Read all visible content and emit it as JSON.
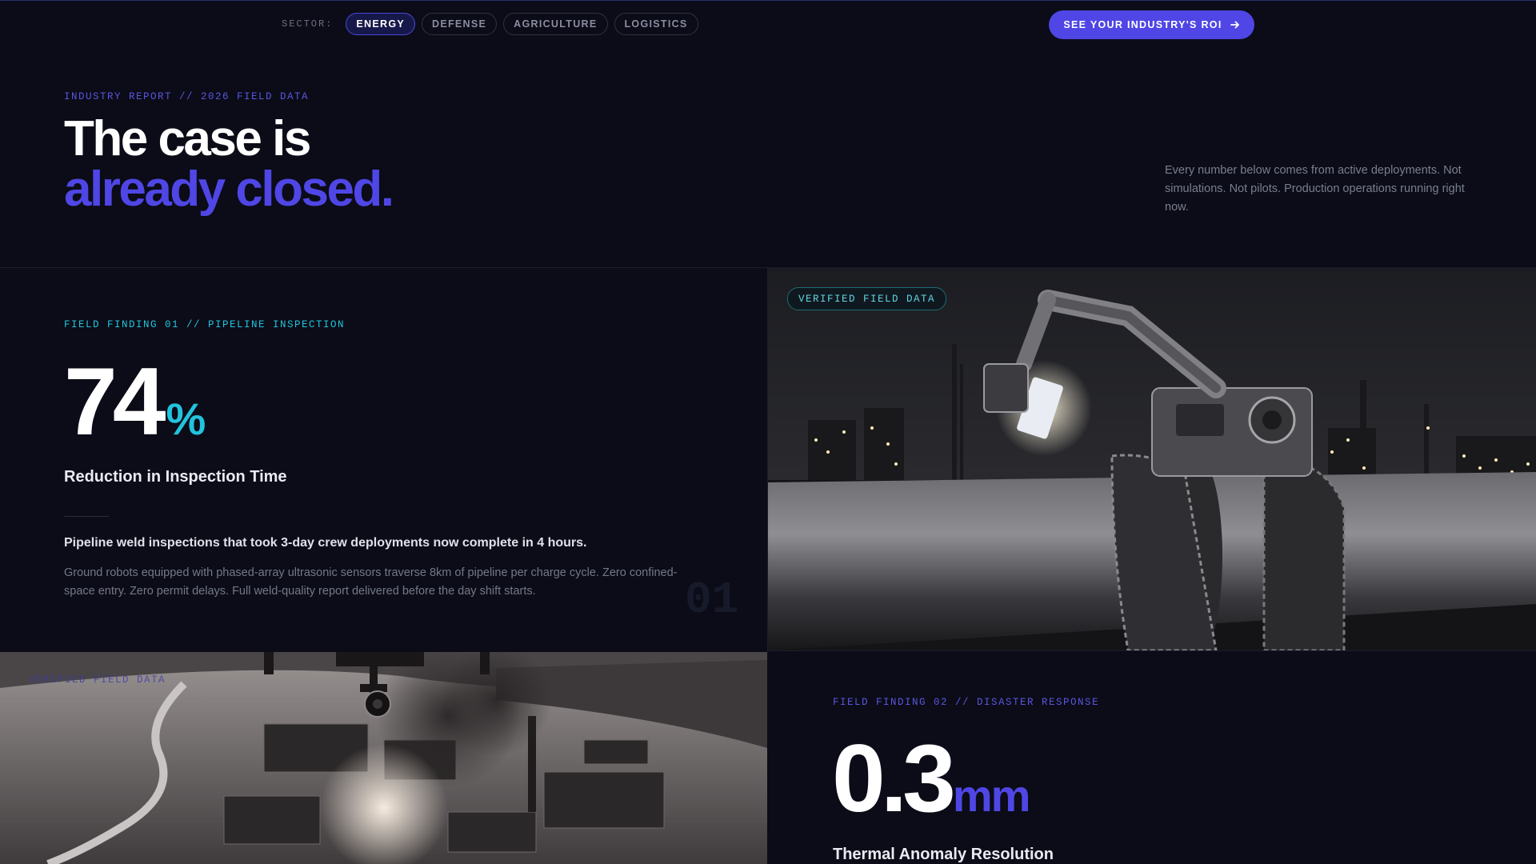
{
  "nav": {
    "sector_label": "SECTOR:",
    "sectors": [
      {
        "label": "ENERGY",
        "active": true
      },
      {
        "label": "DEFENSE",
        "active": false
      },
      {
        "label": "AGRICULTURE",
        "active": false
      },
      {
        "label": "LOGISTICS",
        "active": false
      }
    ],
    "cta_label": "SEE YOUR INDUSTRY'S ROI",
    "cta_icon": "arrow-right-icon"
  },
  "hero": {
    "eyebrow": "INDUSTRY REPORT // 2026 FIELD DATA",
    "title_line1": "The case is",
    "title_line2": "already closed.",
    "description": "Every number below comes from active deployments. Not simulations. Not pilots. Production operations running right now."
  },
  "finding1": {
    "eyebrow": "FIELD FINDING 01 // PIPELINE INSPECTION",
    "value": "74",
    "unit": "%",
    "subtitle": "Reduction in Inspection Time",
    "lead": "Pipeline weld inspections that took 3-day crew deployments now complete in 4 hours.",
    "body": "Ground robots equipped with phased-array ultrasonic sensors traverse 8km of pipeline per charge cycle. Zero confined-space entry. Zero permit delays. Full weld-quality report delivered before the day shift starts.",
    "index": "01",
    "image_badge": "VERIFIED FIELD DATA"
  },
  "finding2": {
    "image_badge": "VERIFIED FIELD DATA",
    "eyebrow": "FIELD FINDING 02 // DISASTER RESPONSE",
    "value": "0.3",
    "unit": "mm",
    "subtitle": "Thermal Anomaly Resolution"
  },
  "colors": {
    "background": "#0b0c17",
    "accent_indigo": "#4f46e5",
    "accent_cyan": "#22c3dd"
  }
}
